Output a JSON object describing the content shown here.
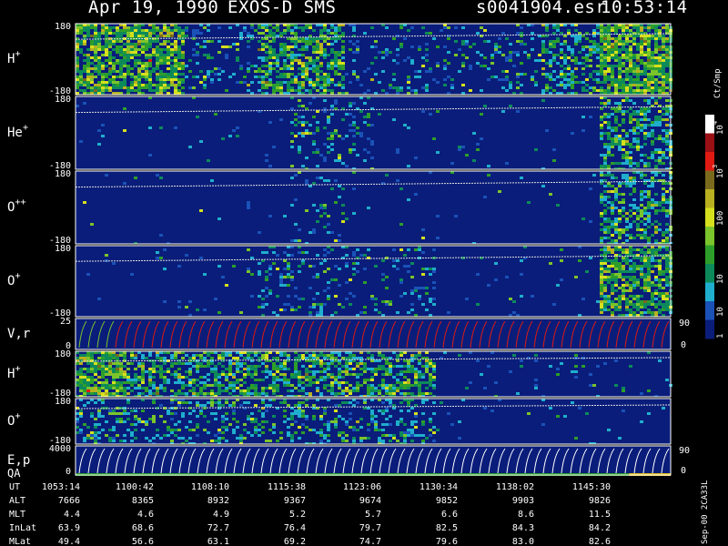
{
  "header": {
    "date": "Apr 19, 1990",
    "instrument": "EXOS-D SMS",
    "file": "s0041904.esr",
    "time": "10:53:14"
  },
  "colorbar": {
    "unit": "Ct/Smp",
    "scale": "log",
    "tick_labels": [
      "10",
      "10",
      "100",
      "10",
      "10"
    ],
    "tick_exponents": [
      "4",
      "3",
      "",
      "",
      ""
    ],
    "bottom_label": "1",
    "colors": [
      "#0a1d7a",
      "#1a52b8",
      "#1faecd",
      "#0d8a5a",
      "#2e9e2a",
      "#7cc42b",
      "#d6e01d",
      "#b8b020",
      "#7a6a1e",
      "#e01a12",
      "#9a1014",
      "#ffffff"
    ]
  },
  "side_label": "Sep-00  2CA33L",
  "chart_data": {
    "type": "heatmap",
    "x_axis": {
      "label": "UT",
      "ticks": [
        "1053:14",
        "1100:42",
        "1108:10",
        "1115:38",
        "1123:06",
        "1130:34",
        "1138:02",
        "1145:30"
      ]
    },
    "panels": [
      {
        "label": "H",
        "superscript": "+",
        "y_top": "180",
        "y_bottom": "-180",
        "kind": "spectrogram"
      },
      {
        "label": "He",
        "superscript": "+",
        "y_top": "180",
        "y_bottom": "-180",
        "kind": "spectrogram"
      },
      {
        "label": "O",
        "superscript": "++",
        "y_top": "180",
        "y_bottom": "-180",
        "kind": "spectrogram"
      },
      {
        "label": "O",
        "superscript": "+",
        "y_top": "180",
        "y_bottom": "-180",
        "kind": "spectrogram"
      },
      {
        "label": "V,r",
        "superscript": "",
        "y_top": "25",
        "y_bottom": "0",
        "right_top": "90",
        "right_bottom": "0",
        "kind": "lines"
      },
      {
        "label": "H",
        "superscript": "+",
        "y_top": "180",
        "y_bottom": "-180",
        "kind": "spectrogram"
      },
      {
        "label": "O",
        "superscript": "+",
        "y_top": "180",
        "y_bottom": "-180",
        "kind": "spectrogram"
      },
      {
        "label": "E,p",
        "superscript": "",
        "y_top": "4000",
        "y_bottom": "0",
        "right_top": "90",
        "right_bottom": "0",
        "kind": "lines",
        "label2": "QA"
      }
    ],
    "orbit_table": {
      "rows": [
        {
          "name": "UT",
          "values": [
            "1053:14",
            "1100:42",
            "1108:10",
            "1115:38",
            "1123:06",
            "1130:34",
            "1138:02",
            "1145:30"
          ]
        },
        {
          "name": "ALT",
          "values": [
            "7666",
            "8365",
            "8932",
            "9367",
            "9674",
            "9852",
            "9903",
            "9826"
          ]
        },
        {
          "name": "MLT",
          "values": [
            "4.4",
            "4.6",
            "4.9",
            "5.2",
            "5.7",
            "6.6",
            "8.6",
            "11.5"
          ]
        },
        {
          "name": "InLat",
          "values": [
            "63.9",
            "68.6",
            "72.7",
            "76.4",
            "79.7",
            "82.5",
            "84.3",
            "84.2"
          ]
        },
        {
          "name": "MLat",
          "values": [
            "49.4",
            "56.6",
            "63.1",
            "69.2",
            "74.7",
            "79.6",
            "83.0",
            "82.6"
          ]
        }
      ]
    }
  }
}
